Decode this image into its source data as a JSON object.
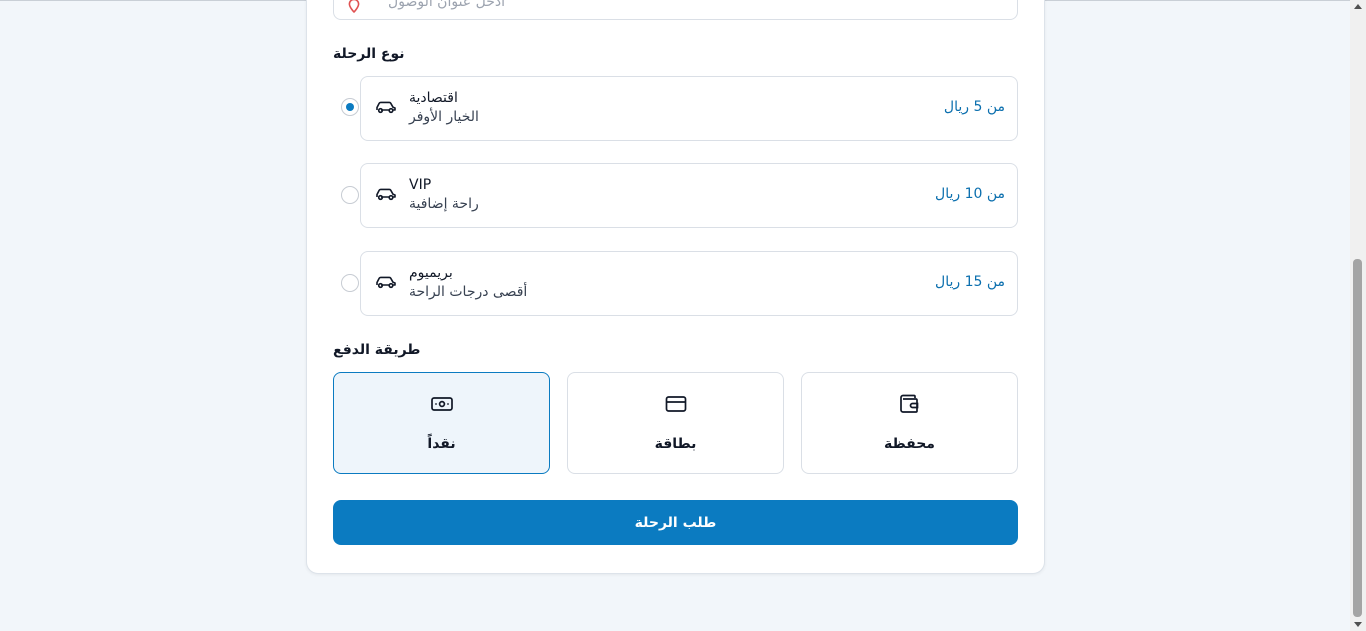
{
  "destination": {
    "placeholder": "أدخل عنوان الوصول"
  },
  "ride_section": {
    "title": "نوع الرحلة",
    "options": [
      {
        "name": "اقتصادية",
        "description": "الخيار الأوفر",
        "price": "من 5 ريال",
        "selected": true,
        "icon": "car-icon"
      },
      {
        "name": "VIP",
        "description": "راحة إضافية",
        "price": "من 10 ريال",
        "selected": false,
        "icon": "car-icon"
      },
      {
        "name": "بريميوم",
        "description": "أقصى درجات الراحة",
        "price": "من 15 ريال",
        "selected": false,
        "icon": "car-icon"
      }
    ]
  },
  "payment_section": {
    "title": "طريقة الدفع",
    "methods": [
      {
        "label": "محفظة",
        "icon": "wallet-icon",
        "selected": false
      },
      {
        "label": "بطاقة",
        "icon": "credit-card-icon",
        "selected": false
      },
      {
        "label": "نقداً",
        "icon": "cash-icon",
        "selected": true
      }
    ]
  },
  "submit": {
    "label": "طلب الرحلة"
  },
  "colors": {
    "accent": "#0b7bc1",
    "price": "#0b6fae",
    "background": "#f2f6fa",
    "pin": "#e05252"
  }
}
